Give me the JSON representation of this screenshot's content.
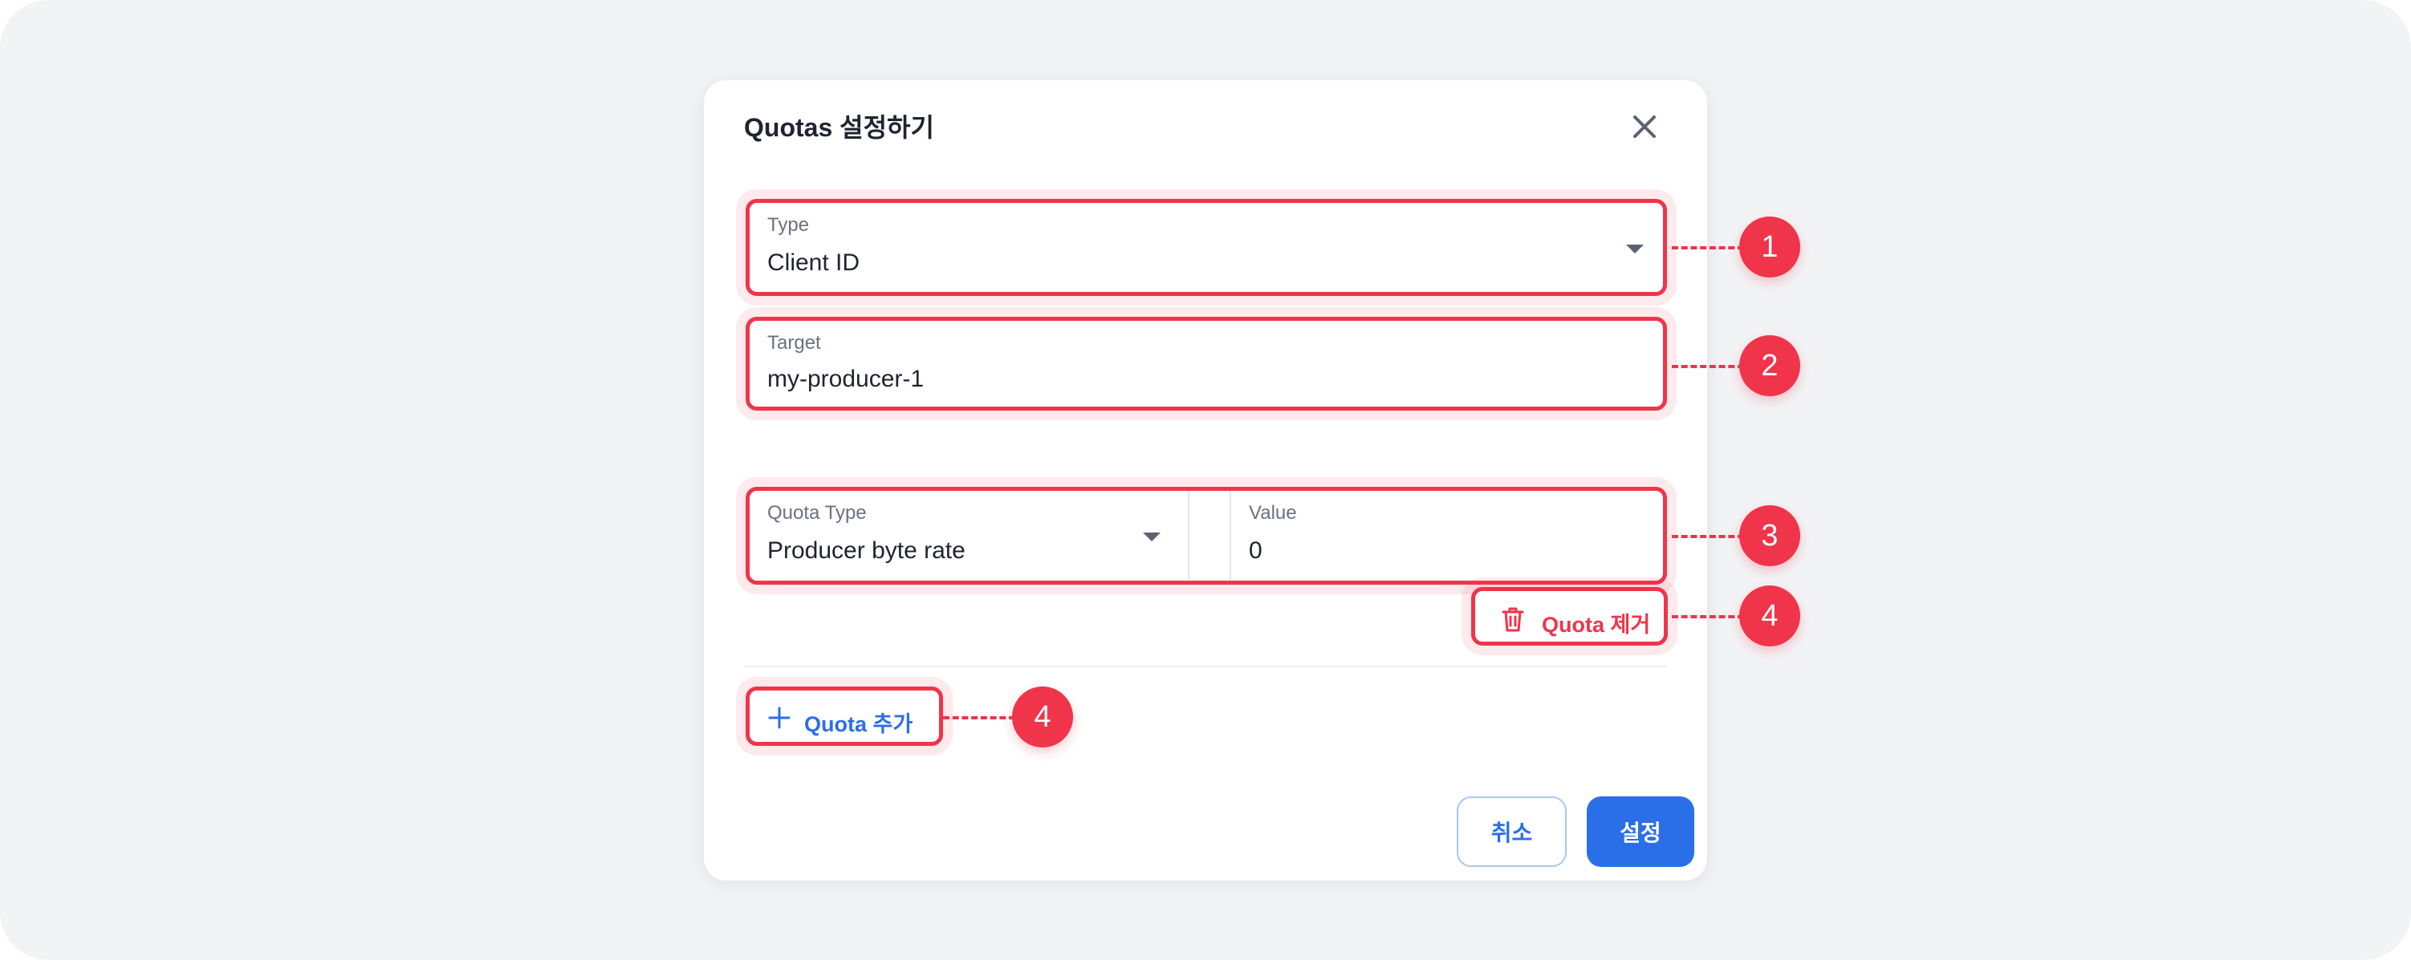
{
  "dialog": {
    "title": "Quotas 설정하기",
    "close_icon": "close-icon"
  },
  "fields": {
    "type": {
      "label": "Type",
      "value": "Client ID"
    },
    "target": {
      "label": "Target",
      "value": "my-producer-1"
    },
    "quota_type": {
      "label": "Quota Type",
      "value": "Producer byte rate"
    },
    "quota_value": {
      "label": "Value",
      "value": "0"
    }
  },
  "actions": {
    "remove_quota": "Quota 제거",
    "add_quota": "Quota 추가",
    "cancel": "취소",
    "confirm": "설정"
  },
  "callouts": [
    "1",
    "2",
    "3",
    "4",
    "4"
  ],
  "colors": {
    "highlight": "#f0344a",
    "primary": "#2b6fe8",
    "canvas": "#f2f3f5",
    "modal": "#ffffff"
  }
}
